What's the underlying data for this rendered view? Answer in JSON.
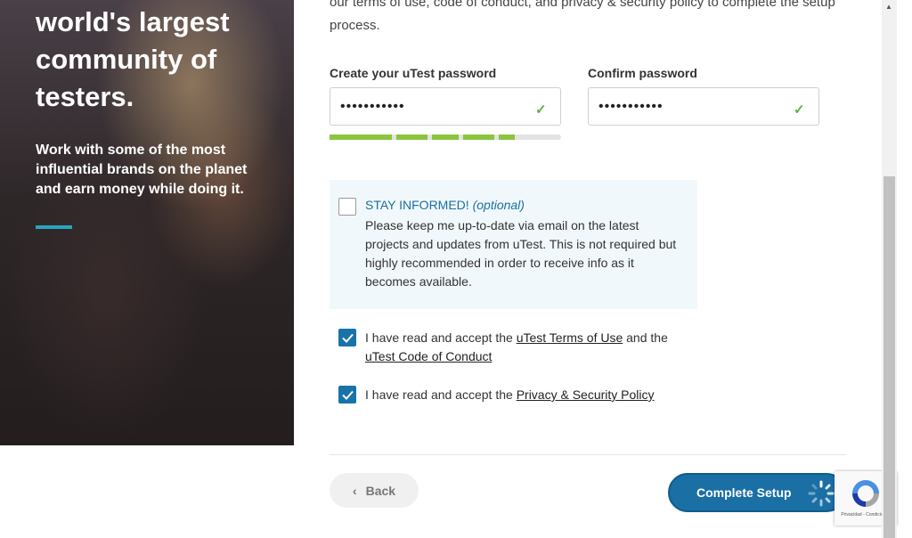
{
  "hero": {
    "title": "world's largest community of testers.",
    "subtitle": "Work with some of the most influential brands on the planet and earn money while doing it."
  },
  "intro": {
    "text": "our terms of use, code of conduct, and privacy & security policy to complete the setup process."
  },
  "password": {
    "label": "Create your uTest password",
    "value": "•••••••••••",
    "strength_fraction": 0.8
  },
  "confirm_password": {
    "label": "Confirm password",
    "value": "•••••••••••"
  },
  "stay_informed": {
    "title": "STAY INFORMED!",
    "optional": "(optional)",
    "text": "Please keep me up-to-date via email on the latest projects and updates from uTest. This is not required but highly recommended in order to receive info as it becomes available.",
    "checked": false
  },
  "terms": {
    "prefix": "I have read and accept the",
    "link1": "uTest Terms of Use",
    "middle": "and the",
    "link2": "uTest Code of Conduct",
    "checked": true
  },
  "privacy": {
    "prefix": "I have read and accept the",
    "link": "Privacy & Security Policy",
    "checked": true
  },
  "buttons": {
    "back": "Back",
    "complete": "Complete Setup"
  },
  "recaptcha": {
    "text": "Privacidad - Condiciones"
  },
  "colors": {
    "accent": "#1a73a8",
    "strength": "#8ac53e",
    "hero_accent": "#2aa3c0"
  }
}
